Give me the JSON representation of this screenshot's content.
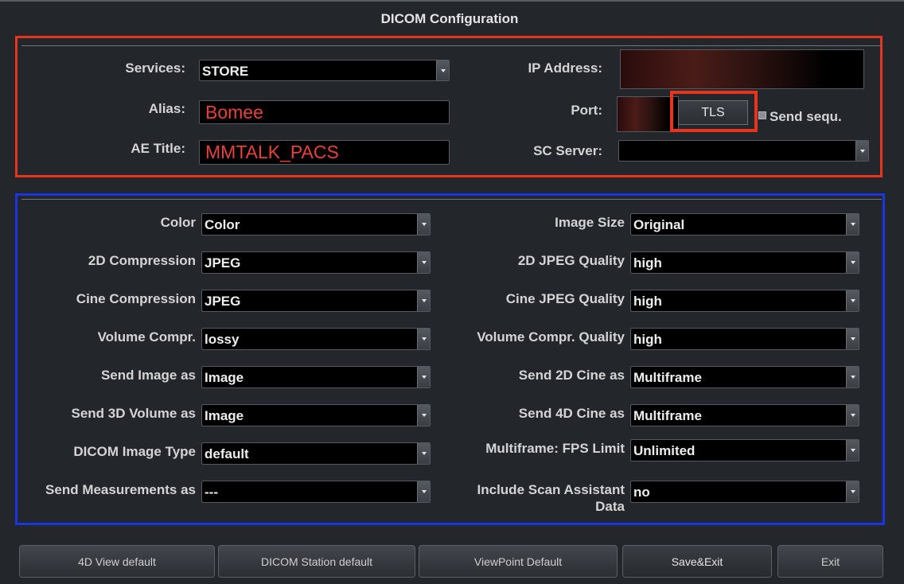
{
  "title": "DICOM Configuration",
  "connection": {
    "services": {
      "label": "Services:",
      "value": "STORE"
    },
    "alias": {
      "label": "Alias:",
      "value": "Bomee"
    },
    "ae_title": {
      "label": "AE Title:",
      "value": "MMTALK_PACS"
    },
    "ip_address": {
      "label": "IP Address:"
    },
    "port": {
      "label": "Port:"
    },
    "tls_button": "TLS",
    "send_sequ": "Send sequ.",
    "sc_server": {
      "label": "SC Server:",
      "value": ""
    }
  },
  "settings": {
    "left": [
      {
        "label": "Color",
        "value": "Color"
      },
      {
        "label": "2D Compression",
        "value": "JPEG"
      },
      {
        "label": "Cine Compression",
        "value": "JPEG"
      },
      {
        "label": "Volume Compr.",
        "value": "lossy"
      },
      {
        "label": "Send Image as",
        "value": "Image"
      },
      {
        "label": "Send 3D Volume as",
        "value": "Image"
      },
      {
        "label": "DICOM Image Type",
        "value": "default"
      },
      {
        "label": "Send Measurements as",
        "value": "---"
      }
    ],
    "right": [
      {
        "label": "Image Size",
        "value": "Original"
      },
      {
        "label": "2D JPEG Quality",
        "value": "high"
      },
      {
        "label": "Cine JPEG Quality",
        "value": "high"
      },
      {
        "label": "Volume Compr. Quality",
        "value": "high"
      },
      {
        "label": "Send 2D Cine as",
        "value": "Multiframe"
      },
      {
        "label": "Send 4D Cine as",
        "value": "Multiframe"
      },
      {
        "label": "Multiframe: FPS Limit",
        "value": "Unlimited"
      },
      {
        "label_line1": "Include Scan Assistant",
        "label_line2": "Data",
        "value": "no"
      }
    ]
  },
  "buttons": {
    "view4d_default": "4D View default",
    "dicom_station_default": "DICOM Station default",
    "viewpoint_default": "ViewPoint Default",
    "save_exit": "Save&Exit",
    "exit": "Exit"
  },
  "colors": {
    "red_frame": "#e8341c",
    "blue_frame": "#1b35e0",
    "value_red": "#e8403a"
  }
}
